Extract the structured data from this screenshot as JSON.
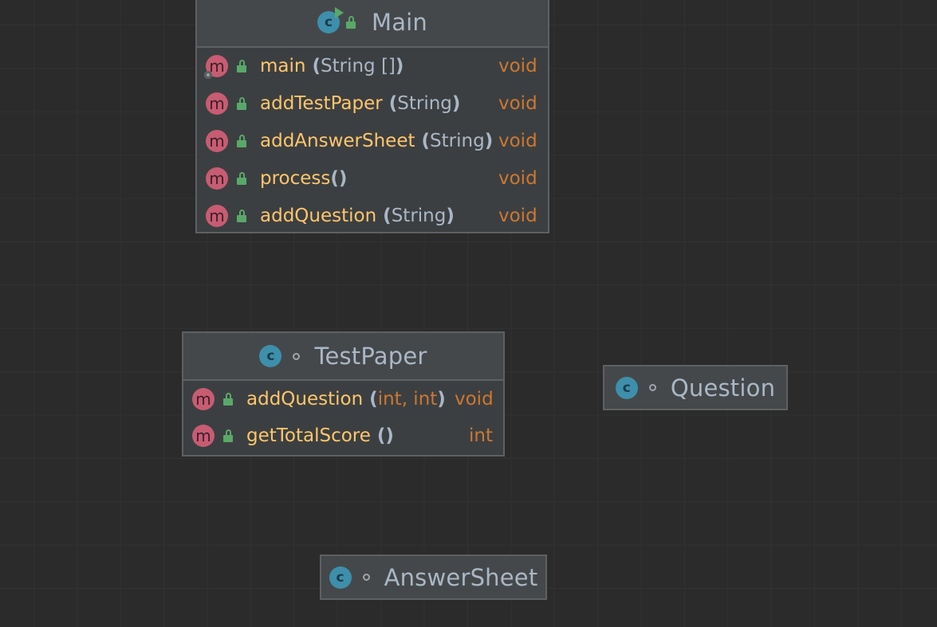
{
  "diagram": {
    "classes": [
      {
        "id": "main",
        "name": "Main",
        "kind_icon": "class-icon",
        "run_badge": true,
        "visibility_icon": "public-lock-icon",
        "methods": [
          {
            "name": "main",
            "params": "String []",
            "return": "void",
            "static": true
          },
          {
            "name": "addTestPaper",
            "params": "String",
            "return": "void"
          },
          {
            "name": "addAnswerSheet",
            "params": "String",
            "return": "void"
          },
          {
            "name": "process",
            "params": "",
            "return": "void"
          },
          {
            "name": "addQuestion",
            "params": "String",
            "return": "void"
          }
        ]
      },
      {
        "id": "testpaper",
        "name": "TestPaper",
        "kind_icon": "class-icon",
        "visibility_icon": "package-private-icon",
        "methods": [
          {
            "name": "addQuestion",
            "params": "int, int",
            "return": "void"
          },
          {
            "name": "getTotalScore",
            "params": "",
            "return": "int"
          }
        ]
      },
      {
        "id": "question",
        "name": "Question",
        "kind_icon": "class-icon",
        "visibility_icon": "package-private-icon",
        "methods": []
      },
      {
        "id": "answersheet",
        "name": "AnswerSheet",
        "kind_icon": "class-icon",
        "visibility_icon": "package-private-icon",
        "methods": []
      }
    ],
    "icons": {
      "class_letter": "c",
      "method_letter": "m"
    },
    "colors": {
      "background": "#2b2b2b",
      "node_fill": "#3c3f41",
      "node_header": "#45484a",
      "node_border": "#5e6062",
      "method_name": "#ffc66d",
      "keyword": "#cc7832",
      "text": "#a9b7c6",
      "class_icon": "#3d8fab",
      "method_icon": "#c75c73",
      "public_lock": "#59a869"
    }
  }
}
